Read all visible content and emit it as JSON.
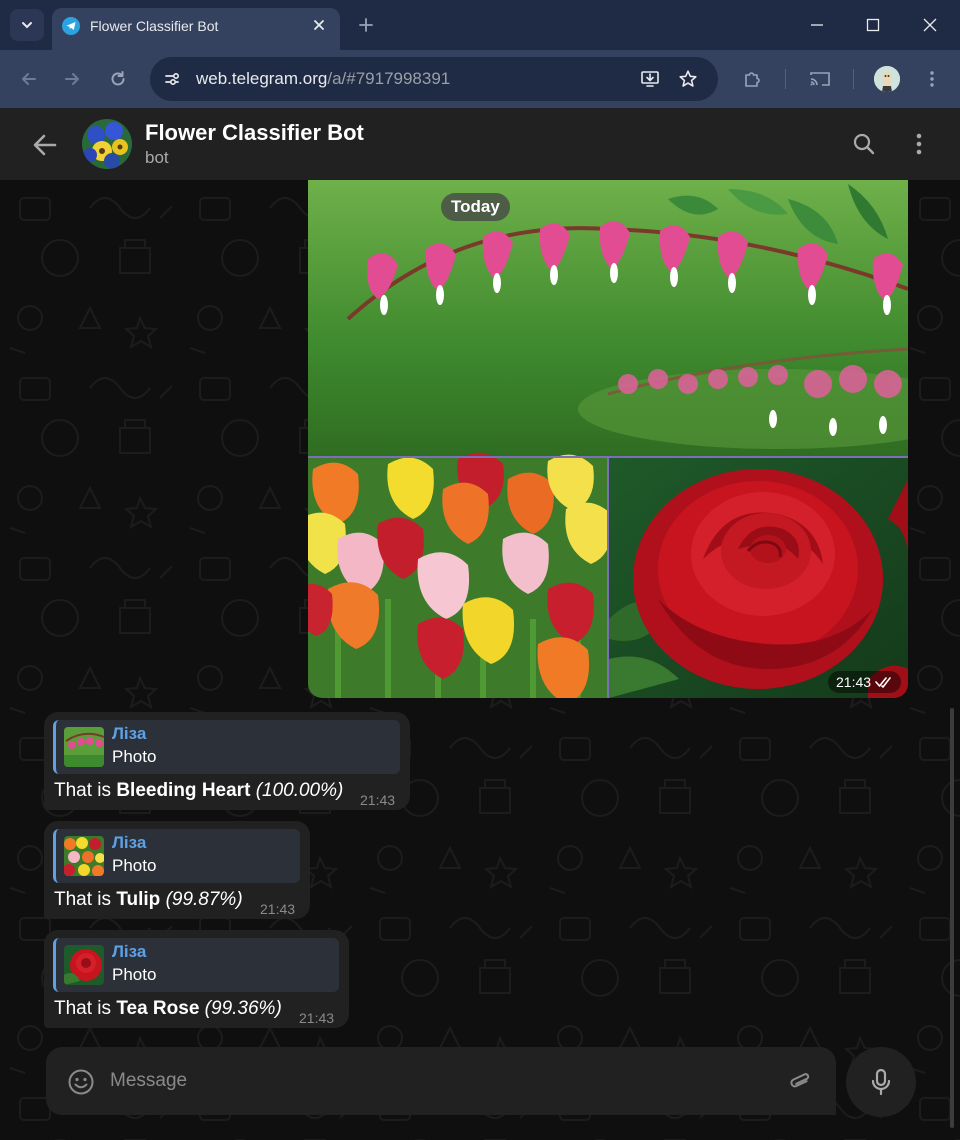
{
  "browser": {
    "tab_title": "Flower Classifier Bot",
    "url_host": "web.telegram.org",
    "url_path": "/a/#7917998391",
    "icons": [
      "tab-search-icon",
      "telegram-favicon",
      "close-icon",
      "plus-icon",
      "minimize-icon",
      "maximize-icon",
      "window-close-icon",
      "back-arrow-icon",
      "forward-arrow-icon",
      "reload-icon",
      "site-info-icon",
      "install-app-icon",
      "star-icon",
      "extensions-icon",
      "cast-icon",
      "profile-avatar",
      "menu-icon"
    ]
  },
  "chat": {
    "title": "Flower Classifier Bot",
    "status": "bot",
    "date_separator": "Today",
    "album": {
      "photos": [
        "bleeding-heart-photo",
        "tulips-photo",
        "red-rose-photo"
      ],
      "time": "21:43",
      "read_status": "read"
    },
    "messages": [
      {
        "reply_sender": "Ліза",
        "reply_text": "Photo",
        "prefix": "That is ",
        "flower": "Bleeding Heart",
        "confidence": "(100.00%)",
        "time": "21:43"
      },
      {
        "reply_sender": "Ліза",
        "reply_text": "Photo",
        "prefix": "That is ",
        "flower": "Tulip",
        "confidence": "(99.87%)",
        "time": "21:43"
      },
      {
        "reply_sender": "Ліза",
        "reply_text": "Photo",
        "prefix": "That is ",
        "flower": "Tea Rose",
        "confidence": "(99.36%)",
        "time": "21:43"
      }
    ]
  },
  "composer": {
    "placeholder": "Message"
  },
  "colors": {
    "browser_tabbar": "#1f2a44",
    "browser_toolbar": "#35425f",
    "chat_background": "#0f0f0f",
    "bubble": "#212121",
    "accent": "#5ea1e6"
  }
}
